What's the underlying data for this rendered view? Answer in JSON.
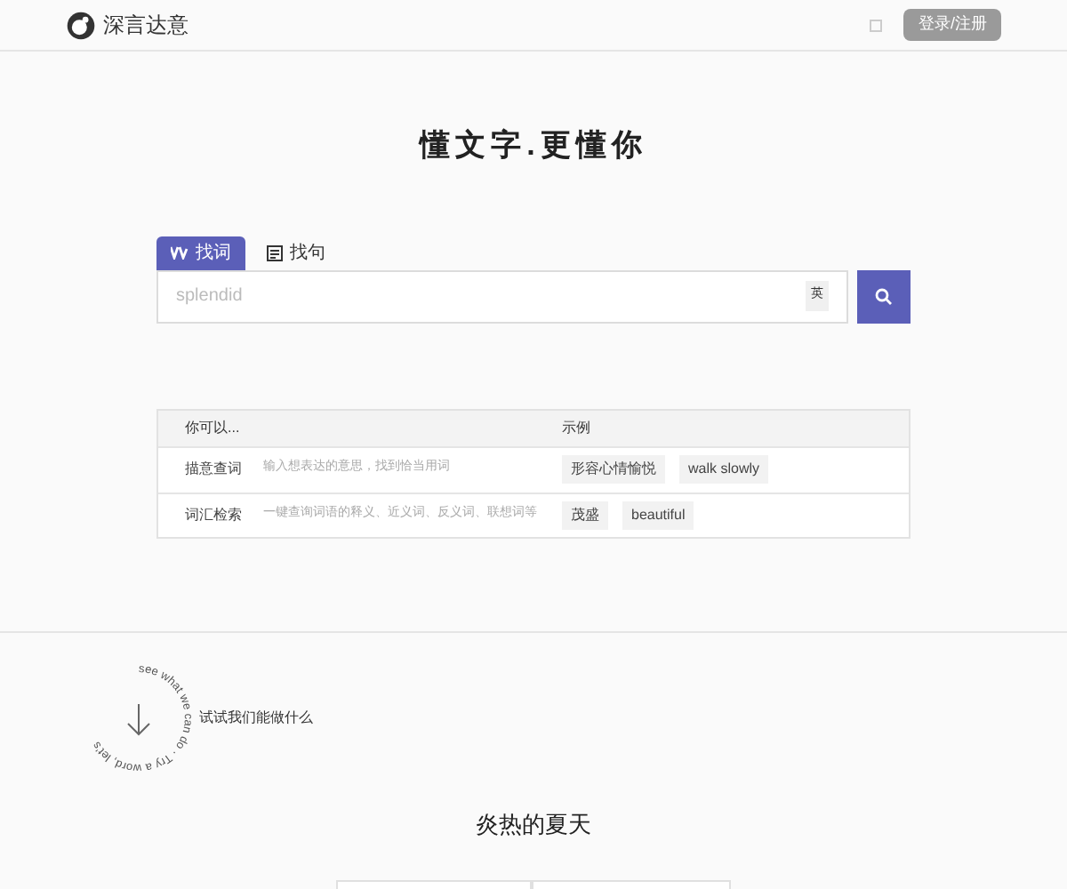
{
  "header": {
    "logo_text": "深言达意",
    "login_button": "登录/注册"
  },
  "hero": {
    "title": "懂文字.更懂你"
  },
  "tabs": [
    {
      "label": "找词",
      "selected": true
    },
    {
      "label": "找句",
      "selected": false
    }
  ],
  "search": {
    "placeholder": "splendid",
    "lang_badge": "英"
  },
  "table": {
    "columns": [
      "你可以...",
      "示例"
    ],
    "rows": [
      {
        "name": "描意查词",
        "description": "输入想表达的意思，找到恰当用词",
        "examples": [
          "形容心情愉悦",
          "walk slowly"
        ]
      },
      {
        "name": "词汇检索",
        "description": "一键查询词语的释义、近义词、反义词、联想词等",
        "examples": [
          "茂盛",
          "beautiful"
        ]
      }
    ]
  },
  "try_section": {
    "circle_text": "see what we can do · Try a word, let's",
    "label": "试试我们能做什么"
  },
  "featured": {
    "title": "炎热的夏天"
  }
}
